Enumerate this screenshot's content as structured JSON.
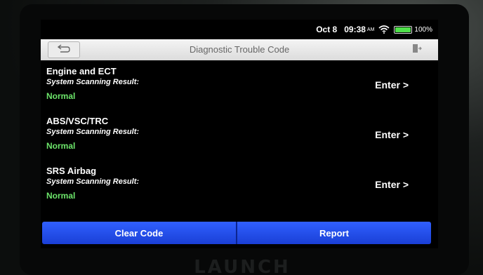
{
  "status_bar": {
    "date": "Oct 8",
    "time": "09:38",
    "ampm": "AM",
    "battery": "100%",
    "icons": [
      "wifi-icon",
      "battery-icon"
    ]
  },
  "header": {
    "title": "Diagnostic Trouble Code",
    "back_icon": "back-arrow-icon",
    "exit_icon": "exit-icon"
  },
  "systems": [
    {
      "name": "Engine and ECT",
      "scan_label": "System Scanning Result:",
      "result": "Normal",
      "action": "Enter >"
    },
    {
      "name": "ABS/VSC/TRC",
      "scan_label": "System Scanning Result:",
      "result": "Normal",
      "action": "Enter >"
    },
    {
      "name": "SRS Airbag",
      "scan_label": "System Scanning Result:",
      "result": "Normal",
      "action": "Enter >"
    }
  ],
  "footer": {
    "clear_code_label": "Clear Code",
    "report_label": "Report"
  },
  "device": {
    "logo": "LAUNCH"
  },
  "colors": {
    "accent": "#2a55f5",
    "normal": "#6ce56a",
    "battery": "#4fe04a"
  }
}
